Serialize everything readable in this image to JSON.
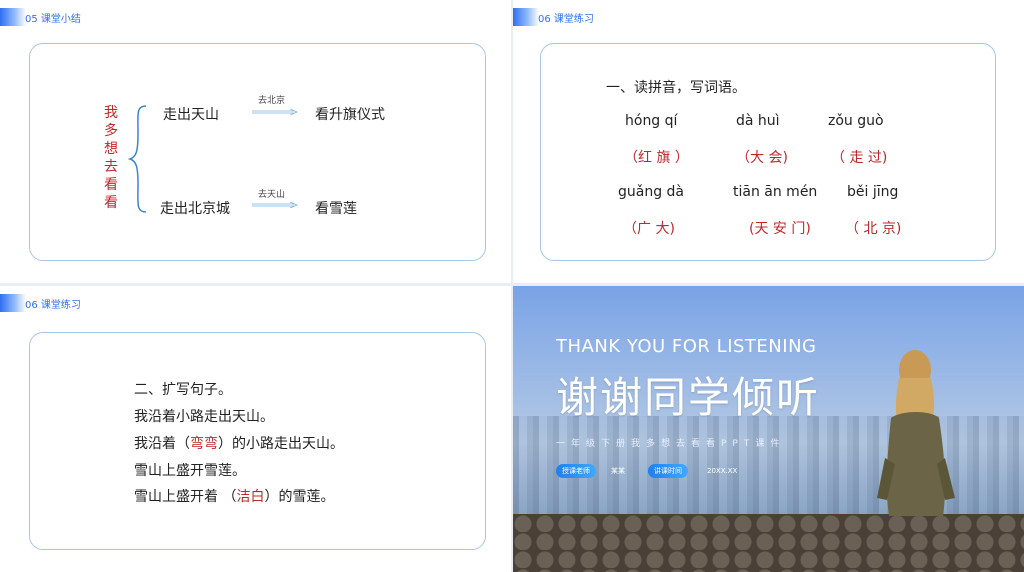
{
  "slide1": {
    "header": "05  课堂小结",
    "vertical_text": [
      "我",
      "多",
      "想",
      "去",
      "看",
      "看"
    ],
    "row1": {
      "left": "走出天山",
      "via": "去北京",
      "right": "看升旗仪式"
    },
    "row2": {
      "left": "走出北京城",
      "via": "去天山",
      "right": "看雪莲"
    }
  },
  "slide2": {
    "header": "06  课堂练习",
    "title": "一、读拼音，写词语。",
    "items": [
      {
        "pinyin": "hóng  qí",
        "answer": "（红 旗 ）"
      },
      {
        "pinyin": "dà  huì",
        "answer": "（大 会)"
      },
      {
        "pinyin": "zǒu guò",
        "answer": "（ 走 过)"
      },
      {
        "pinyin": "guǎng dà",
        "answer": "（广  大)"
      },
      {
        "pinyin": "tiān ān mén",
        "answer": "(天 安 门)"
      },
      {
        "pinyin": "běi jīng",
        "answer": "（ 北 京)"
      }
    ]
  },
  "slide3": {
    "header": "06  课堂练习",
    "title": "二、扩写句子。",
    "line1": "我沿着小路走出天山。",
    "line2_pre": "我沿着（",
    "line2_fill": "弯弯",
    "line2_post": "）的小路走出天山。",
    "line3": "雪山上盛开雪莲。",
    "line4_pre": "雪山上盛开着  （",
    "line4_fill": "洁白",
    "line4_post": "）的雪莲。"
  },
  "slide4": {
    "english": "THANK YOU FOR LISTENING",
    "title": "谢谢同学倾听",
    "subtitle": "一年级下册我多想去看看PPT课件",
    "teacher_label": "授课老师",
    "teacher_value": "某某",
    "time_label": "讲课时间",
    "time_value": "20XX.XX"
  },
  "colors": {
    "accent": "#2f6ff0",
    "answer_red": "#c0282a",
    "card_border": "#a8c6e3"
  }
}
